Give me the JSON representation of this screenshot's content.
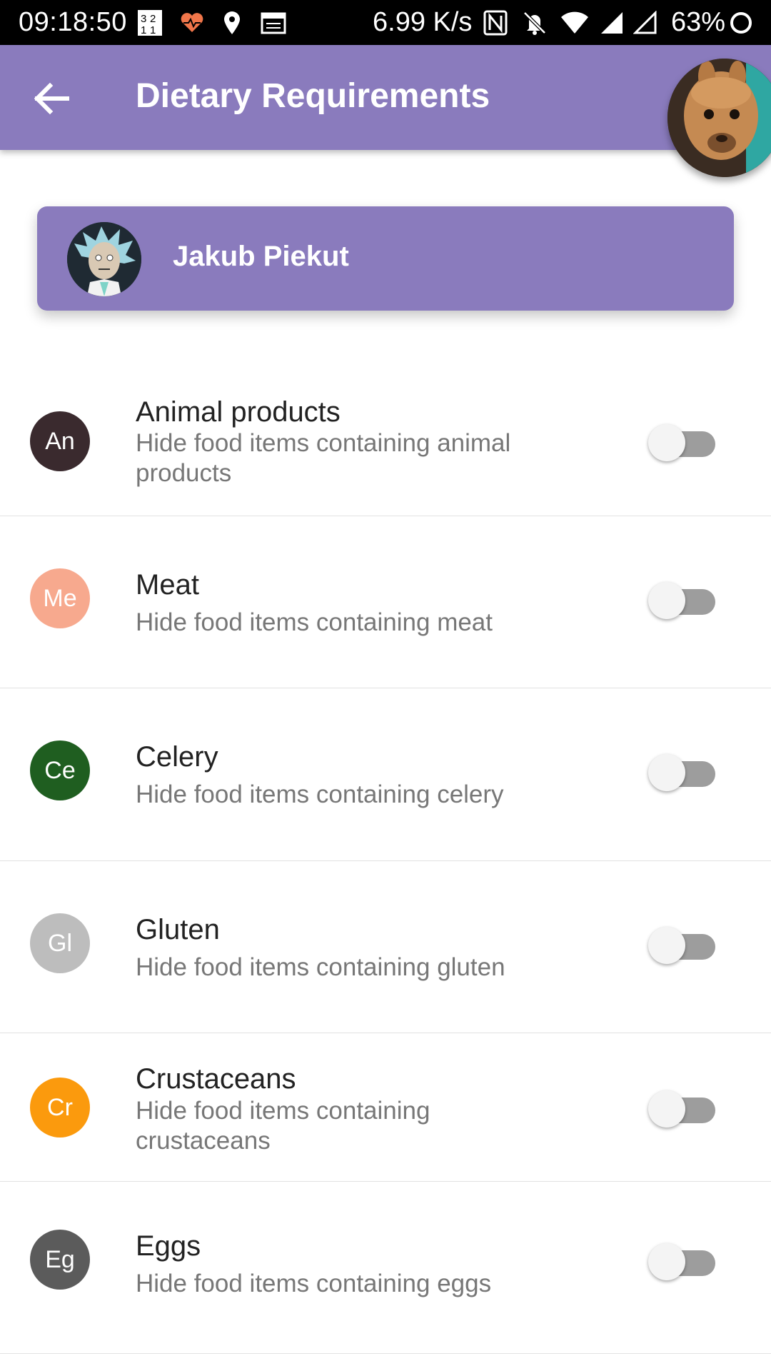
{
  "status_bar": {
    "time": "09:18:50",
    "speed": "6.99 K/s",
    "battery": "63%",
    "icons": [
      "calendar-grid-icon",
      "heart-icon",
      "location-pin-icon",
      "card-icon",
      "nfc-icon",
      "bell-off-icon",
      "wifi-icon",
      "signal-icon",
      "signal-outline-icon",
      "loading-ring-icon"
    ]
  },
  "app_bar": {
    "title": "Dietary Requirements",
    "back_icon": "arrow-back-icon",
    "avatar": "alpaca-avatar"
  },
  "profile": {
    "name": "Jakub Piekut",
    "avatar": "cartoon-scientist-avatar"
  },
  "colors": {
    "primary": "#8a7bbd",
    "an": "#3a2a2e",
    "me": "#f7a98e",
    "ce": "#1f5e20",
    "gl": "#bdbdbd",
    "cr": "#fb9a0d",
    "eg": "#5b5b5b"
  },
  "items": [
    {
      "abbr": "An",
      "title": "Animal products",
      "subtitle": "Hide food items containing animal products",
      "enabled": false
    },
    {
      "abbr": "Me",
      "title": "Meat",
      "subtitle": "Hide food items containing meat",
      "enabled": false
    },
    {
      "abbr": "Ce",
      "title": "Celery",
      "subtitle": "Hide food items containing celery",
      "enabled": false
    },
    {
      "abbr": "Gl",
      "title": "Gluten",
      "subtitle": "Hide food items containing gluten",
      "enabled": false
    },
    {
      "abbr": "Cr",
      "title": "Crustaceans",
      "subtitle": "Hide food items containing crustaceans",
      "enabled": false
    },
    {
      "abbr": "Eg",
      "title": "Eggs",
      "subtitle": "Hide food items containing eggs",
      "enabled": false
    }
  ]
}
